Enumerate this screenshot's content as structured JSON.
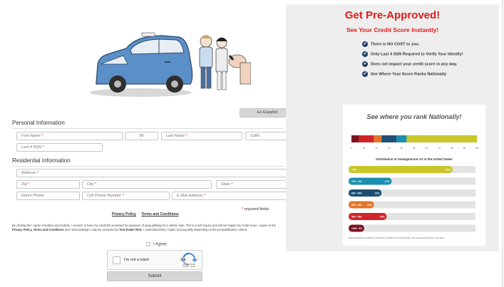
{
  "form": {
    "lang_button": "En Español",
    "personal_title": "Personal Information",
    "first_name": "First Name",
    "mi": "MI",
    "last_name": "Last Name",
    "suffix": "Suffix",
    "ssn4": "Last 4 SSN",
    "residential_title": "Residential Information",
    "address": "Address",
    "zip": "Zip",
    "city": "City",
    "state": "State",
    "home_phone": "Home Phone",
    "cell_phone": "Cell Phone Number",
    "email": "E-Mail Address",
    "required_mark": "*",
    "required_note": "required fields",
    "privacy_link": "Privacy Policy",
    "terms_link": "Terms and Conditions",
    "consent": {
      "p1": "By clicking the I Agree checkbox and Submit, I consent to have my credit file accessed for purposes of prequalifying for a vehicle loan. This is a soft inquiry and will not impact my credit score. I agree to the ",
      "b1": "Privacy Policy, Terms and Conditions",
      "p2": " and I acknowledge I may be contacted by ",
      "b2": "Test Dealer Rick",
      "p3": ". I understand that I might not prequalify depending on the prequalification criteria."
    },
    "agree_label": "I Agree",
    "captcha_label": "I'm not a robot",
    "captcha_brand": "reCAPTCHA",
    "captcha_terms": "Privacy - Terms",
    "submit": "Submit"
  },
  "panel": {
    "title": "Get Pre-Approved!",
    "subtitle": "See Your Credit Score Instantly!",
    "bullets": [
      "There is NO COST to you.",
      "Only Last 4 SSN Required to Verify Your Identity!",
      "Does not impact your credit score in any way.",
      "See Where Your Score Ranks Nationally"
    ],
    "rank_title": "See where you rank Nationally!",
    "dist_title": "Distribution of VantageScore 3.0 in the United States",
    "footnote": "National Ranking provided by TransUnion. Subject to full Credit Profile. Your pre-approval expires in 30 days.",
    "icons": {
      "check": "check-circle-icon"
    }
  },
  "colors": {
    "accent_red": "#e21a1a",
    "check_navy": "#1f3d66",
    "field_border": "#c6c6c6",
    "panel_bg": "#eeeeee"
  },
  "chart_data": {
    "type": "bar",
    "title": "Distribution of VantageScore 3.0 in the United States",
    "scale_ticks": [
      "0",
      "10",
      "20",
      "30",
      "40",
      "50",
      "60",
      "70",
      "80",
      "90",
      "100"
    ],
    "gradient_segments": [
      {
        "color": "#7a1420",
        "width": 6
      },
      {
        "color": "#d1232a",
        "width": 12
      },
      {
        "color": "#e1762a",
        "width": 6
      },
      {
        "color": "#1d4f74",
        "width": 12
      },
      {
        "color": "#1b8fb1",
        "width": 8
      },
      {
        "color": "#c9c62a",
        "width": 56
      }
    ],
    "categories": [
      "750+",
      "700 - 749",
      "650 - 699",
      "600 - 649",
      "500 - 599",
      "<500"
    ],
    "values": [
      41,
      17,
      13,
      10,
      15,
      5
    ],
    "value_labels": [
      "41%",
      "17%",
      "13%",
      "10%",
      "15%",
      "5%"
    ],
    "bar_colors": [
      "#c9c62a",
      "#1b8fb1",
      "#1d4f74",
      "#e1762a",
      "#d1232a",
      "#7a1420"
    ],
    "xlim": [
      0,
      50
    ]
  }
}
